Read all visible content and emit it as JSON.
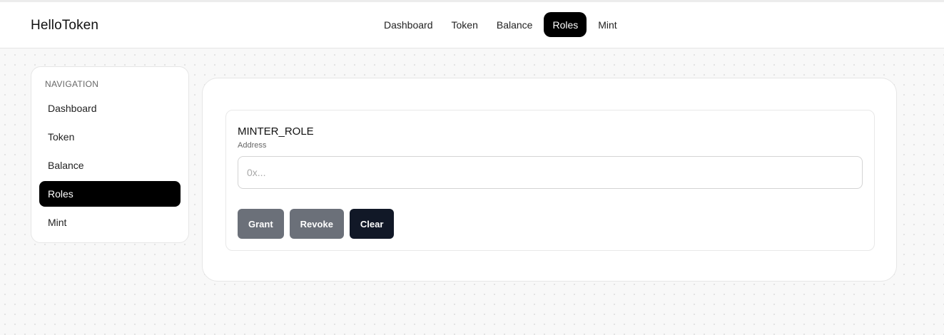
{
  "app": {
    "brand": "HelloToken"
  },
  "topnav": {
    "items": [
      {
        "label": "Dashboard",
        "active": false
      },
      {
        "label": "Token",
        "active": false
      },
      {
        "label": "Balance",
        "active": false
      },
      {
        "label": "Roles",
        "active": true
      },
      {
        "label": "Mint",
        "active": false
      }
    ]
  },
  "sidebar": {
    "heading": "NAVIGATION",
    "items": [
      {
        "label": "Dashboard",
        "active": false
      },
      {
        "label": "Token",
        "active": false
      },
      {
        "label": "Balance",
        "active": false
      },
      {
        "label": "Roles",
        "active": true
      },
      {
        "label": "Mint",
        "active": false
      }
    ]
  },
  "role_panel": {
    "title": "MINTER_ROLE",
    "address_label": "Address",
    "address_value": "",
    "address_placeholder": "0x...",
    "buttons": {
      "grant": "Grant",
      "revoke": "Revoke",
      "clear": "Clear"
    }
  },
  "colors": {
    "accent": "#000000",
    "button_grey": "#6b7079",
    "button_dark": "#111827"
  }
}
